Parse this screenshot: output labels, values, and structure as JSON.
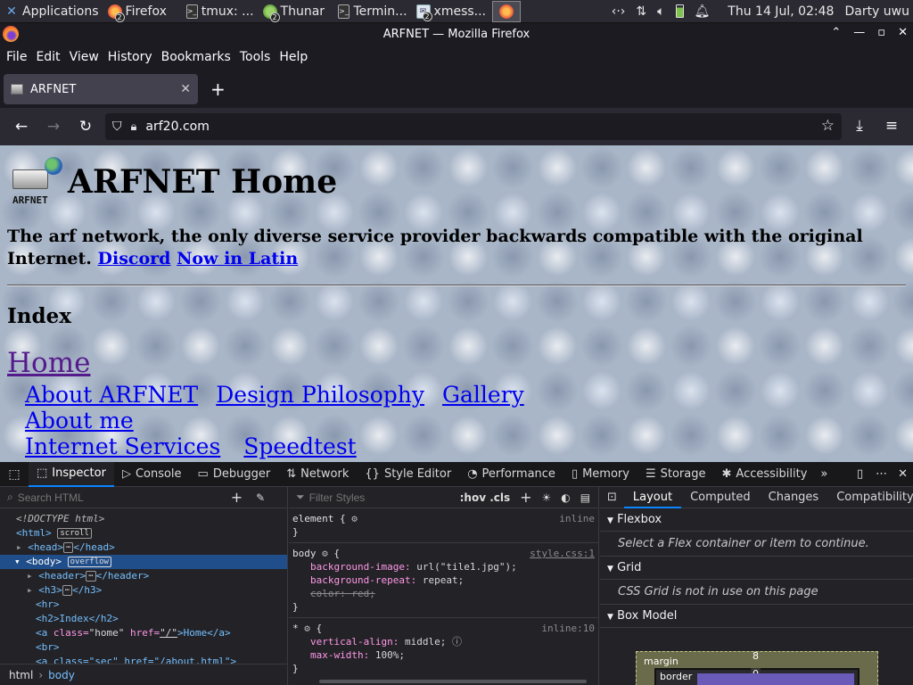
{
  "taskbar": {
    "items": [
      {
        "label": "Applications",
        "icon": "xfce-mouse-icon"
      },
      {
        "label": "Firefox",
        "icon": "firefox-icon",
        "badge": "2"
      },
      {
        "label": "tmux: ...",
        "icon": "terminal-icon"
      },
      {
        "label": "Thunar",
        "icon": "thunar-icon",
        "badge": "2"
      },
      {
        "label": "Termin...",
        "icon": "terminal-icon"
      },
      {
        "label": "xmess...",
        "icon": "xmessage-icon",
        "badge": "2"
      }
    ],
    "clock": "Thu 14 Jul, 02:48",
    "user": "Darty uwu"
  },
  "window": {
    "title": "ARFNET — Mozilla Firefox"
  },
  "menu": {
    "file": "File",
    "edit": "Edit",
    "view": "View",
    "history": "History",
    "bookmarks": "Bookmarks",
    "tools": "Tools",
    "help": "Help"
  },
  "tab": {
    "label": "ARFNET",
    "new_tab": "+"
  },
  "urlbar": {
    "value": "arf20.com"
  },
  "page": {
    "logo_text": "ARFNET",
    "heading": "ARFNET Home",
    "tagline": "The arf network, the only diverse service provider backwards compatible with the original Internet.",
    "link_discord": "Discord",
    "link_latin": "Now in Latin",
    "index_heading": "Index",
    "nav_home": "Home",
    "nav_about": "About ARFNET",
    "nav_design": "Design Philosophy",
    "nav_gallery": "Gallery",
    "nav_aboutme": "About me",
    "nav_services": "Internet Services",
    "nav_speedtest": "Speedtest"
  },
  "devtools": {
    "tabs": {
      "inspector": "Inspector",
      "console": "Console",
      "debugger": "Debugger",
      "network": "Network",
      "style_editor": "Style Editor",
      "performance": "Performance",
      "memory": "Memory",
      "storage": "Storage",
      "accessibility": "Accessibility"
    },
    "search_placeholder": "Search HTML",
    "filter_placeholder": "Filter Styles",
    "hov_cls": ":hov .cls",
    "tree": {
      "doctype": "<!DOCTYPE html>",
      "html_tag": "<html>",
      "scroll_badge": "scroll",
      "head_open": "<head>",
      "head_close": "</head>",
      "body_tag": "<body>",
      "overflow_badge": "overflow",
      "header_open": "<header>",
      "header_close": "</header>",
      "h3_open": "<h3>",
      "h3_close": "</h3>",
      "hr": "<hr>",
      "h2_line": "<h2>Index</h2>",
      "a_tag": "<a",
      "a_class_attr": "class=",
      "a_class_val": "\"home\"",
      "a_href_attr": "href=",
      "a_href_val": "\"/\"",
      "a_rest": ">Home</a>",
      "br": "<br>",
      "a2_line": "<a class=\"sec\" href=\"/about.html\">"
    },
    "breadcrumb": {
      "html": "html",
      "body": "body"
    },
    "rules": {
      "element_sel": "element {",
      "element_src": "inline",
      "close": "}",
      "body_sel": "body",
      "body_open": "{",
      "body_src": "style.css:1",
      "bg_image_prop": "background-image:",
      "bg_image_val": "url(\"tile1.jpg\");",
      "bg_repeat_prop": "background-repeat:",
      "bg_repeat_val": "repeat;",
      "color_prop": "color: red;",
      "star_sel": "*",
      "star_open": "{",
      "star_src": "inline:10",
      "valign_prop": "vertical-align:",
      "valign_val": "middle;",
      "maxw_prop": "max-width:",
      "maxw_val": "100%;"
    },
    "layout_tabs": {
      "layout": "Layout",
      "computed": "Computed",
      "changes": "Changes",
      "compat": "Compatibility"
    },
    "flexbox_title": "Flexbox",
    "flexbox_msg": "Select a Flex container or item to continue.",
    "grid_title": "Grid",
    "grid_msg": "CSS Grid is not in use on this page",
    "boxmodel_title": "Box Model",
    "box_margin_label": "margin",
    "box_margin_top": "8",
    "box_border_label": "border",
    "box_border_top": "0"
  }
}
